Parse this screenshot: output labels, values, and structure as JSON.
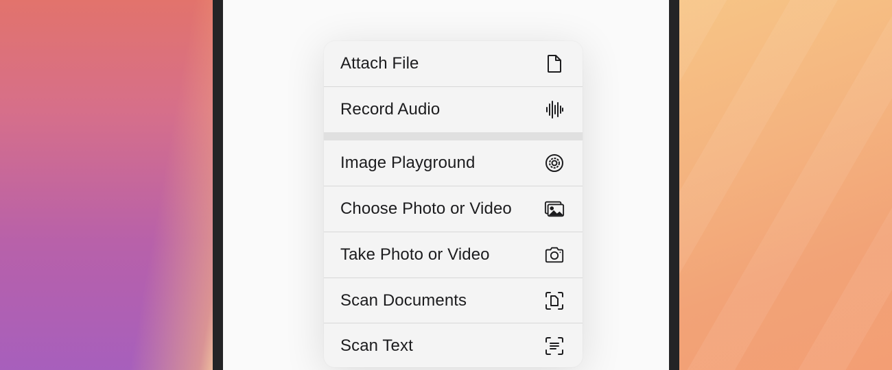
{
  "menu": {
    "items": [
      {
        "label": "Attach File",
        "icon": "doc-icon"
      },
      {
        "label": "Record Audio",
        "icon": "waveform-icon"
      },
      {
        "label": "Image Playground",
        "icon": "image-playground-icon"
      },
      {
        "label": "Choose Photo or Video",
        "icon": "photo-library-icon"
      },
      {
        "label": "Take Photo or Video",
        "icon": "camera-icon"
      },
      {
        "label": "Scan Documents",
        "icon": "doc-viewfinder-icon"
      },
      {
        "label": "Scan Text",
        "icon": "text-viewfinder-icon"
      }
    ]
  }
}
